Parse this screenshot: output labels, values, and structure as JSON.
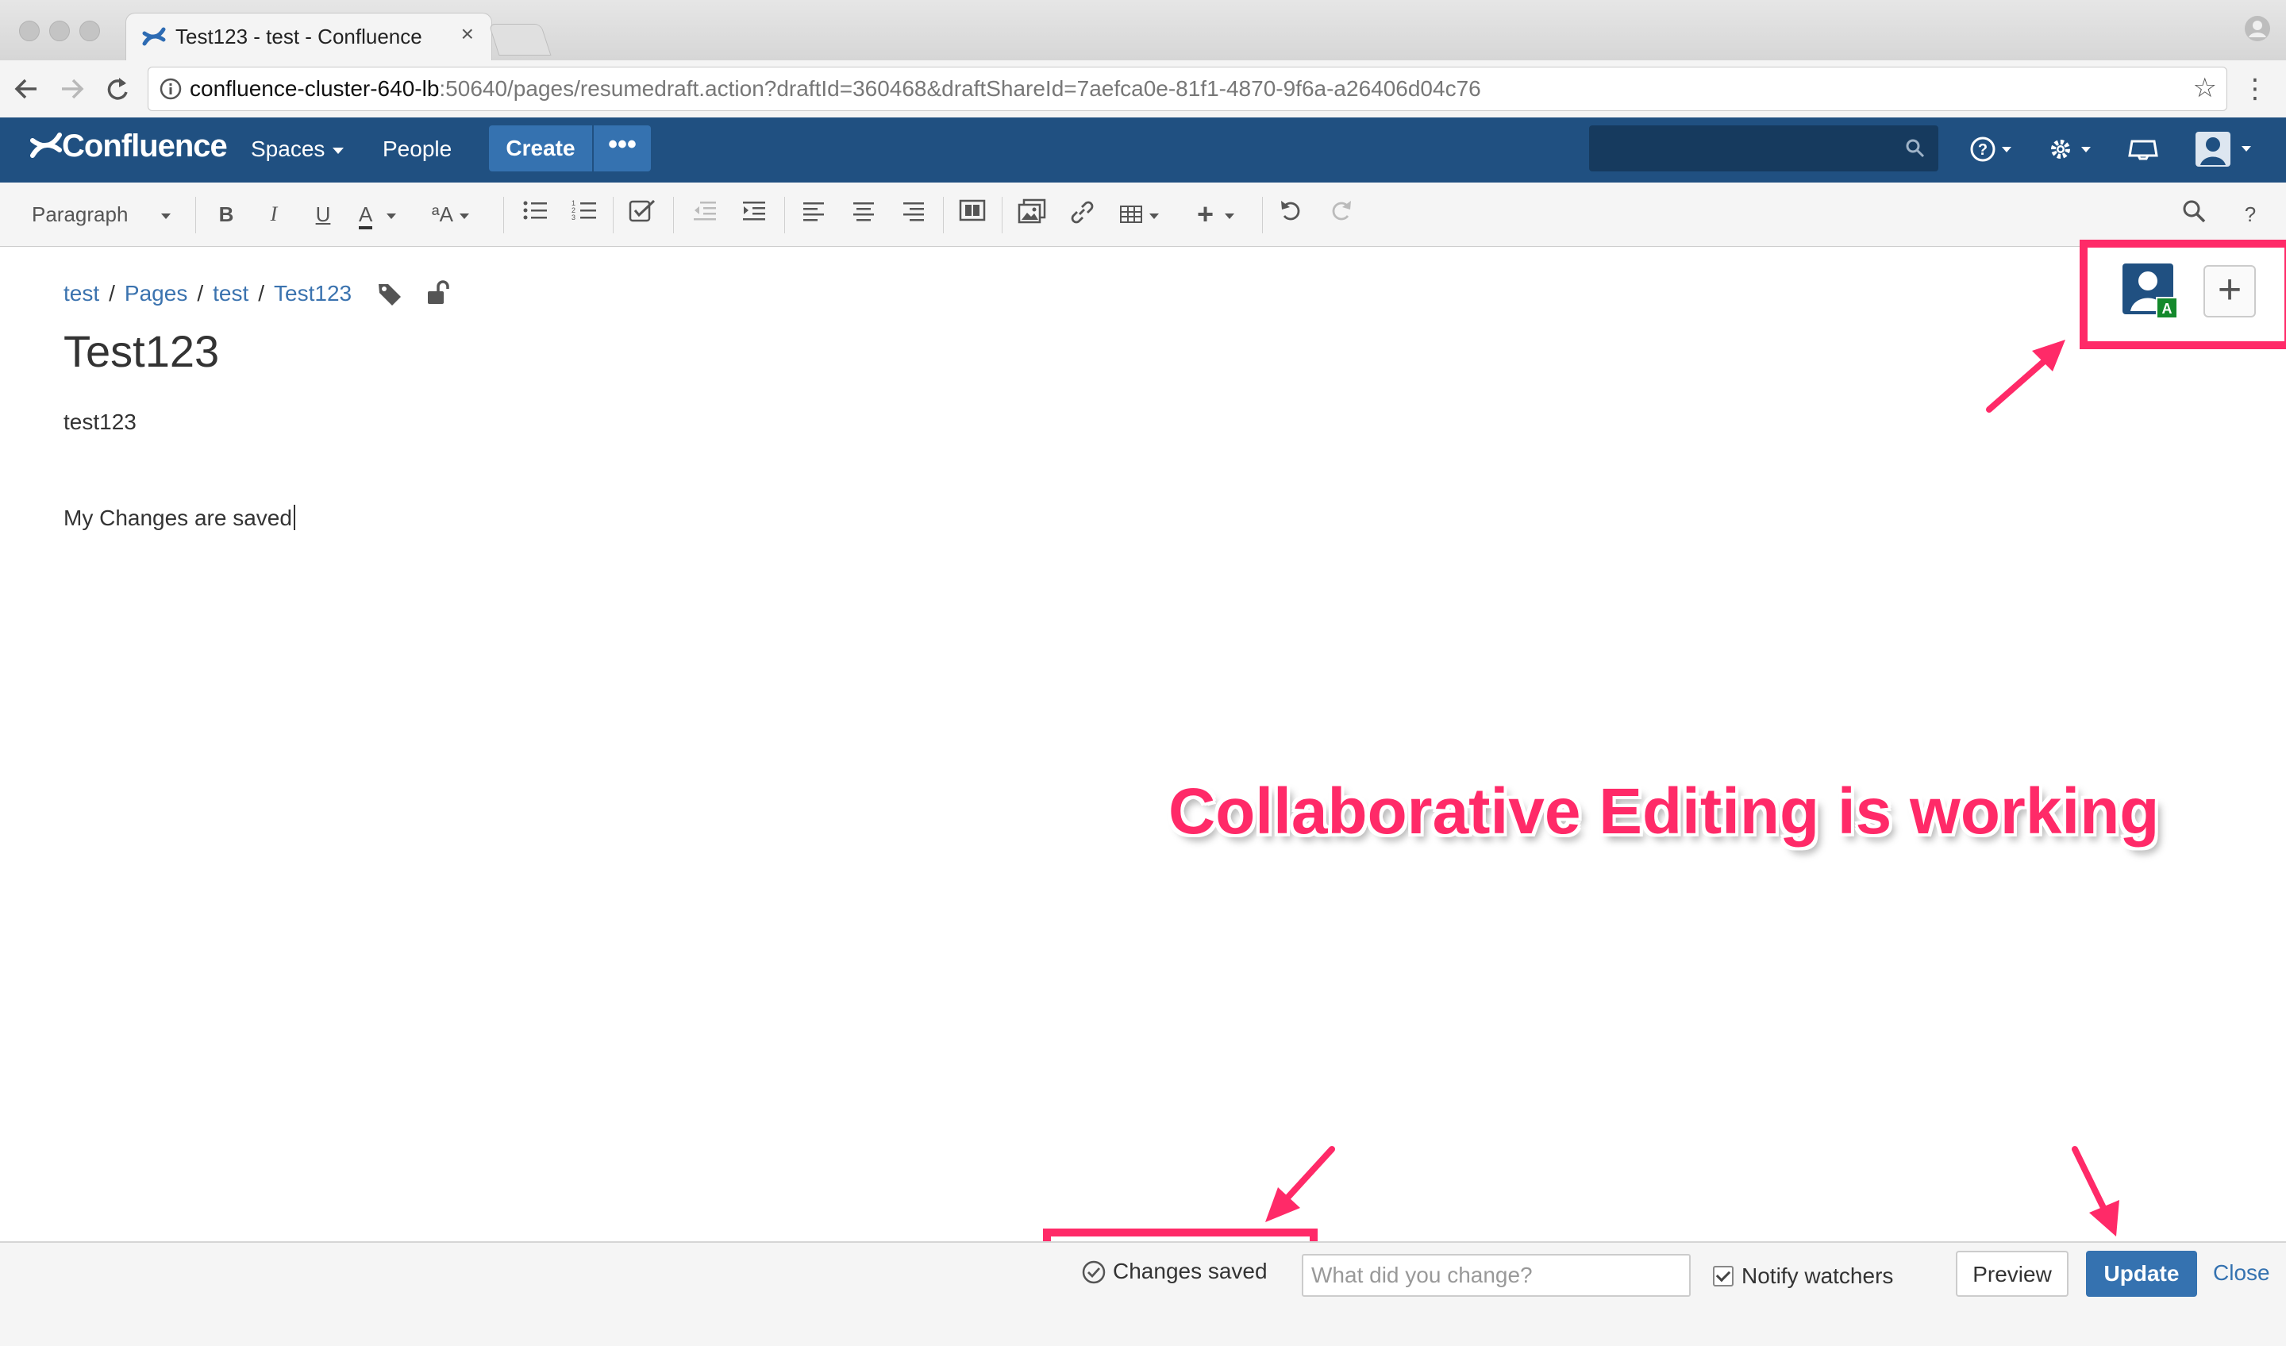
{
  "browser": {
    "tab_title": "Test123 - test - Confluence",
    "tab_close": "×",
    "url_host": "confluence-cluster-640-lb",
    "url_path": ":50640/pages/resumedraft.action?draftId=360468&draftShareId=7aefca0e-81f1-4870-9f6a-a26406d04c76",
    "icons": [
      "back-icon",
      "forward-icon",
      "reload-icon",
      "info-icon",
      "star-icon",
      "menu-icon",
      "profile-icon"
    ]
  },
  "header": {
    "logo": "Confluence",
    "spaces": "Spaces",
    "people": "People",
    "create": "Create",
    "more": "•••",
    "icons": [
      "search-icon",
      "help-icon",
      "settings-icon",
      "notifications-icon",
      "user-avatar-icon"
    ],
    "brand_color": "#205081",
    "button_color": "#3572b0"
  },
  "toolbar": {
    "paragraph": "Paragraph",
    "bold": "B",
    "italic": "I",
    "underline": "U",
    "text_color": "A",
    "formatting": "ªA",
    "help": "?"
  },
  "content": {
    "breadcrumb": [
      "test",
      "Pages",
      "test",
      "Test123"
    ],
    "breadcrumb_sep": "/",
    "title": "Test123",
    "paragraphs": [
      "test123",
      "My Changes are saved"
    ],
    "collaborator_badge": "A",
    "add_collaborator": "+"
  },
  "annotation": {
    "text": "Collaborative Editing is working",
    "color": "#ff2a68"
  },
  "footer": {
    "status": "Changes saved",
    "change_placeholder": "What did you change?",
    "notify": "Notify watchers",
    "preview": "Preview",
    "update": "Update",
    "close": "Close"
  }
}
